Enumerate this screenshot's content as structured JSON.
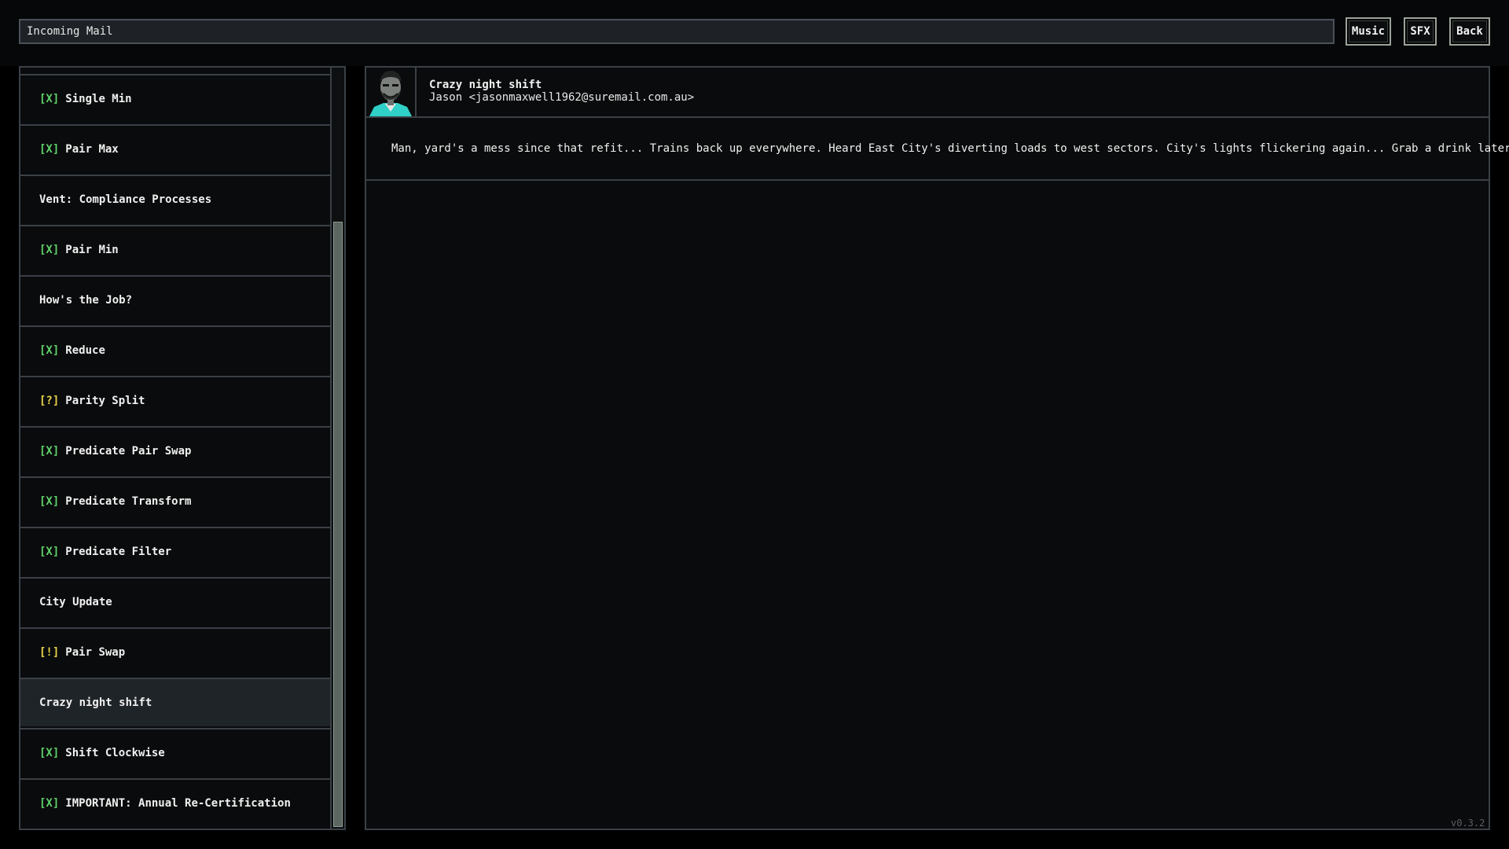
{
  "header": {
    "title": "Incoming Mail",
    "buttons": {
      "music": "Music",
      "sfx": "SFX",
      "back": "Back"
    }
  },
  "mail_list": [
    {
      "tag": "[X]",
      "tag_color": "#5fd16a",
      "label": "Single Min"
    },
    {
      "tag": "[X]",
      "tag_color": "#5fd16a",
      "label": "Pair Max"
    },
    {
      "tag": "",
      "tag_color": "",
      "label": "Vent: Compliance Processes"
    },
    {
      "tag": "[X]",
      "tag_color": "#5fd16a",
      "label": "Pair Min"
    },
    {
      "tag": "",
      "tag_color": "",
      "label": "How's the Job?"
    },
    {
      "tag": "[X]",
      "tag_color": "#5fd16a",
      "label": "Reduce"
    },
    {
      "tag": "[?]",
      "tag_color": "#e8d24a",
      "label": "Parity Split"
    },
    {
      "tag": "[X]",
      "tag_color": "#5fd16a",
      "label": "Predicate Pair Swap"
    },
    {
      "tag": "[X]",
      "tag_color": "#5fd16a",
      "label": "Predicate Transform"
    },
    {
      "tag": "[X]",
      "tag_color": "#5fd16a",
      "label": "Predicate Filter"
    },
    {
      "tag": "",
      "tag_color": "",
      "label": "City Update"
    },
    {
      "tag": "[!]",
      "tag_color": "#e8d24a",
      "label": "Pair Swap"
    },
    {
      "tag": "",
      "tag_color": "",
      "label": "Crazy night shift",
      "selected": true
    },
    {
      "tag": "[X]",
      "tag_color": "#5fd16a",
      "label": "Shift Clockwise"
    },
    {
      "tag": "[X]",
      "tag_color": "#5fd16a",
      "label": "IMPORTANT: Annual Re-Certification"
    }
  ],
  "message": {
    "subject": "Crazy night shift",
    "sender": "Jason <jasonmaxwell1962@suremail.com.au>",
    "body": "Man, yard's a mess since that refit... Trains back up everywhere. Heard East City's diverting loads to west sectors. City's lights flickering again... Grab a drink later?",
    "avatar_icon": "person-avatar-icon"
  },
  "version": "v0.3.2",
  "colors": {
    "accent_green": "#5fd16a",
    "accent_yellow": "#e8d24a",
    "avatar_cyan": "#2fd0c8"
  }
}
